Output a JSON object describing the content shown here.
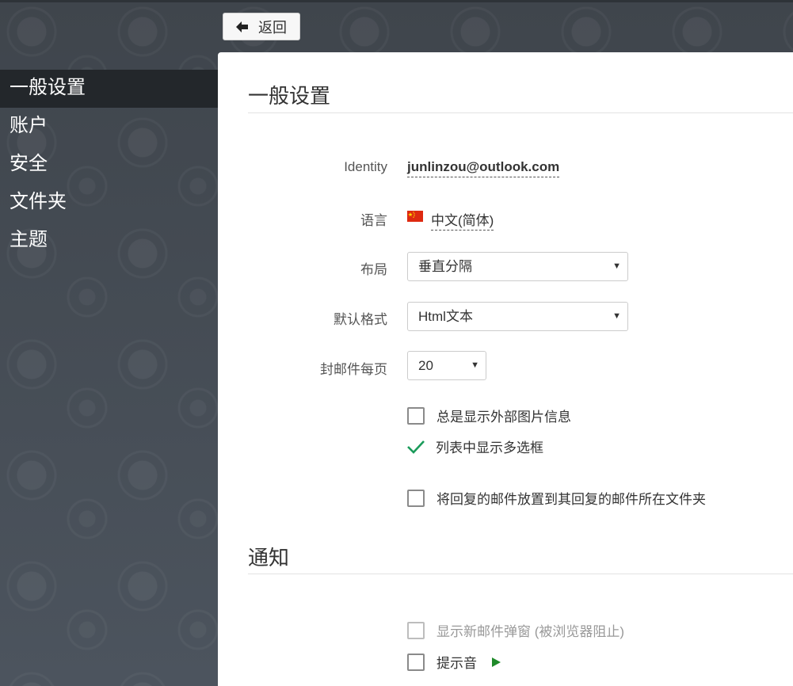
{
  "back_button": {
    "label": "返回"
  },
  "sidebar": {
    "items": [
      {
        "label": "一般设置",
        "active": true
      },
      {
        "label": "账户"
      },
      {
        "label": "安全"
      },
      {
        "label": "文件夹"
      },
      {
        "label": "主题"
      }
    ]
  },
  "general": {
    "title": "一般设置",
    "identity": {
      "label": "Identity",
      "value": "junlinzou@outlook.com"
    },
    "language": {
      "label": "语言",
      "value": "中文(简体)",
      "flag_icon": "china-flag-icon"
    },
    "layout": {
      "label": "布局",
      "value": "垂直分隔"
    },
    "default_format": {
      "label": "默认格式",
      "value": "Html文本"
    },
    "per_page": {
      "label": "封邮件每页",
      "value": "20"
    },
    "options": [
      {
        "label": "总是显示外部图片信息",
        "checked": false
      },
      {
        "label": "列表中显示多选框",
        "checked": true
      },
      {
        "label": "将回复的邮件放置到其回复的邮件所在文件夹",
        "checked": false
      }
    ]
  },
  "notifications": {
    "title": "通知",
    "options": [
      {
        "label": "显示新邮件弹窗 (被浏览器阻止)",
        "checked": false,
        "disabled": true
      },
      {
        "label": "提示音",
        "checked": false,
        "play_icon": "play-icon"
      }
    ]
  },
  "colors": {
    "sidebar_active": "#23272b",
    "check_green": "#1a9b5a",
    "play_green": "#1f8a2a"
  }
}
